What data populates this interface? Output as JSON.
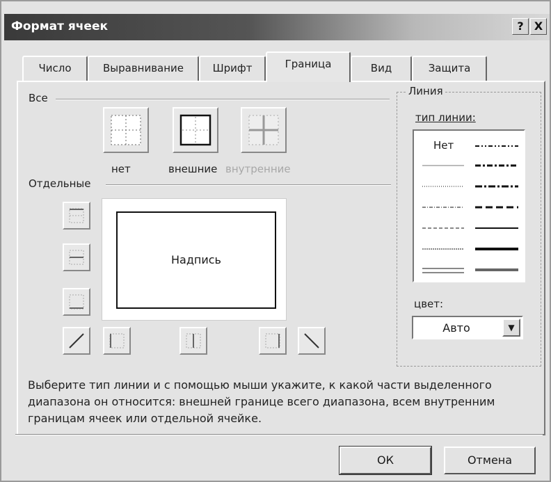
{
  "window": {
    "title": "Формат ячеек",
    "help_btn": "?",
    "close_btn": "X"
  },
  "tabs": [
    {
      "label": "Число",
      "active": false
    },
    {
      "label": "Выравнивание",
      "active": false
    },
    {
      "label": "Шрифт",
      "active": false
    },
    {
      "label": "Граница",
      "active": true
    },
    {
      "label": "Вид",
      "active": false
    },
    {
      "label": "Защита",
      "active": false
    }
  ],
  "all_group": {
    "label": "Все",
    "presets": [
      {
        "label": "нет",
        "icon": "border-none-icon",
        "enabled": true
      },
      {
        "label": "внешние",
        "icon": "border-outline-icon",
        "enabled": true
      },
      {
        "label": "внутренние",
        "icon": "border-inside-icon",
        "enabled": false
      }
    ]
  },
  "separate_group": {
    "label": "Отдельные",
    "preview_text": "Надпись"
  },
  "line_group": {
    "label": "Линия",
    "type_label": "тип линии:",
    "none_label": "Нет",
    "color_label": "цвет:",
    "color_value": "Авто",
    "dropdown_icon": "▼"
  },
  "hint": "Выберите тип линии и с помощью мыши укажите, к какой части выделенного диапазона он относится: внешней границе всего диапазона, всем внутренним границам ячеек или отдельной ячейке.",
  "buttons": {
    "ok": "ОК",
    "cancel": "Отмена"
  }
}
